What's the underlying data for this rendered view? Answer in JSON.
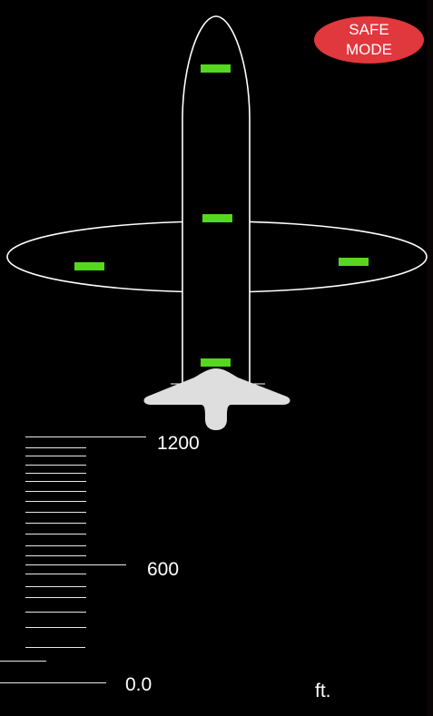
{
  "mode_badge": {
    "line1": "SAFE",
    "line2": "MODE",
    "color": "#e0383d"
  },
  "aircraft": {
    "outline_color": "#ffffff",
    "tail_fill": "#dedede",
    "indicator_color": "#55d81e",
    "indicators": [
      "nose",
      "mid-fuselage",
      "left-wing",
      "right-wing",
      "aft-fuselage"
    ]
  },
  "altitude_scale": {
    "labels": {
      "top": "1200",
      "middle": "600",
      "bottom": "0.0"
    },
    "unit": "ft."
  }
}
